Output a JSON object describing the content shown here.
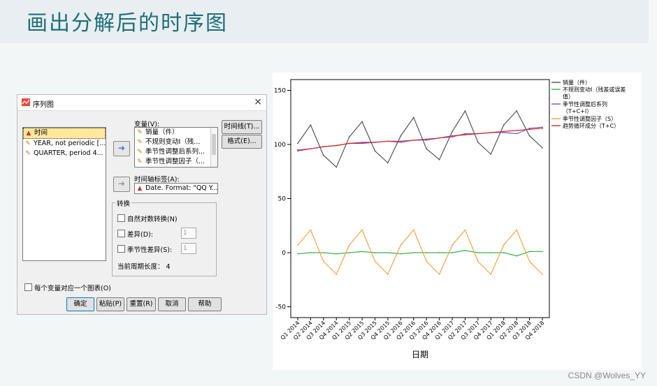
{
  "slide": {
    "title": "画出分解后的时序图",
    "watermark": "CSDN @Wolves_YY"
  },
  "dialog": {
    "title": "序列图",
    "close": "×",
    "variables": [
      {
        "label": "时间",
        "icon": "date-icon",
        "selected": true
      },
      {
        "label": "YEAR, not periodic [...",
        "icon": "ruler-icon",
        "selected": false
      },
      {
        "label": "QUARTER, period 4...",
        "icon": "ruler-icon",
        "selected": false
      }
    ],
    "dep_label": "变量(V):",
    "dep_vars": [
      {
        "label": "销量（件）",
        "icon": "ruler-icon"
      },
      {
        "label": "不规则变动I（残...",
        "icon": "ruler-icon"
      },
      {
        "label": "季节性调整后系列...",
        "icon": "ruler-icon"
      },
      {
        "label": "季节性调整因子（...",
        "icon": "ruler-icon"
      }
    ],
    "axis_label": "时间轴标签(A):",
    "axis_value": "Date. Format: \"QQ Y...",
    "btn_timeline": "时间线(T)...",
    "btn_format": "格式(E)...",
    "transform_title": "转换",
    "chk_log": "自然对数转换(N)",
    "chk_diff": "差异(D):",
    "chk_sdiff": "季节性差异(S):",
    "diff_value": "1",
    "sdiff_value": "1",
    "period_text": "当前周期长度：  4",
    "chk_one_chart": "每个变量对应一个图表(O)",
    "btn_ok": "确定",
    "btn_paste": "粘贴(P)",
    "btn_reset": "重置(R)",
    "btn_cancel": "取消",
    "btn_help": "帮助"
  },
  "chart_data": {
    "type": "line",
    "xlabel": "日期",
    "ylabel": "",
    "ylim": [
      -60,
      160
    ],
    "yticks": [
      -50,
      0,
      50,
      100,
      150
    ],
    "categories": [
      "Q1 2014",
      "Q2 2014",
      "Q3 2014",
      "Q4 2014",
      "Q1 2015",
      "Q2 2015",
      "Q3 2015",
      "Q4 2015",
      "Q1 2016",
      "Q2 2016",
      "Q3 2016",
      "Q4 2016",
      "Q1 2017",
      "Q2 2017",
      "Q3 2017",
      "Q4 2017",
      "Q1 2018",
      "Q2 2018",
      "Q3 2018",
      "Q4 2018"
    ],
    "series": [
      {
        "name": "销量（件）",
        "color": "#555555",
        "values": [
          101,
          118,
          90,
          79,
          107,
          121,
          94,
          83,
          108,
          125,
          96,
          86,
          112,
          131,
          102,
          91,
          118,
          131,
          108,
          97
        ]
      },
      {
        "name": "不规则变动I（残差或误差值）",
        "color": "#3cb44b",
        "values": [
          -1,
          0,
          0,
          -1,
          0,
          1,
          0,
          0,
          -1,
          0,
          0,
          0,
          0,
          2,
          0,
          0,
          0,
          -3,
          1,
          1
        ]
      },
      {
        "name": "季节性调整后系列（T+C+I）",
        "color": "#6a5acd",
        "values": [
          94,
          96,
          98,
          99,
          101,
          102,
          102,
          103,
          102,
          104,
          104,
          106,
          107,
          110,
          110,
          111,
          111,
          110,
          115,
          116
        ]
      },
      {
        "name": "季节性调整因子（S）",
        "color": "#f5a347",
        "values": [
          7,
          21,
          -8,
          -20,
          7,
          21,
          -8,
          -20,
          7,
          21,
          -8,
          -20,
          7,
          21,
          -8,
          -20,
          7,
          21,
          -8,
          -20
        ]
      },
      {
        "name": "趋势循环成分（T+C）",
        "color": "#d62728",
        "values": [
          95,
          96,
          98,
          99,
          101,
          101,
          102,
          103,
          103,
          104,
          105,
          106,
          108,
          109,
          110,
          111,
          112,
          113,
          114,
          115
        ]
      }
    ]
  }
}
